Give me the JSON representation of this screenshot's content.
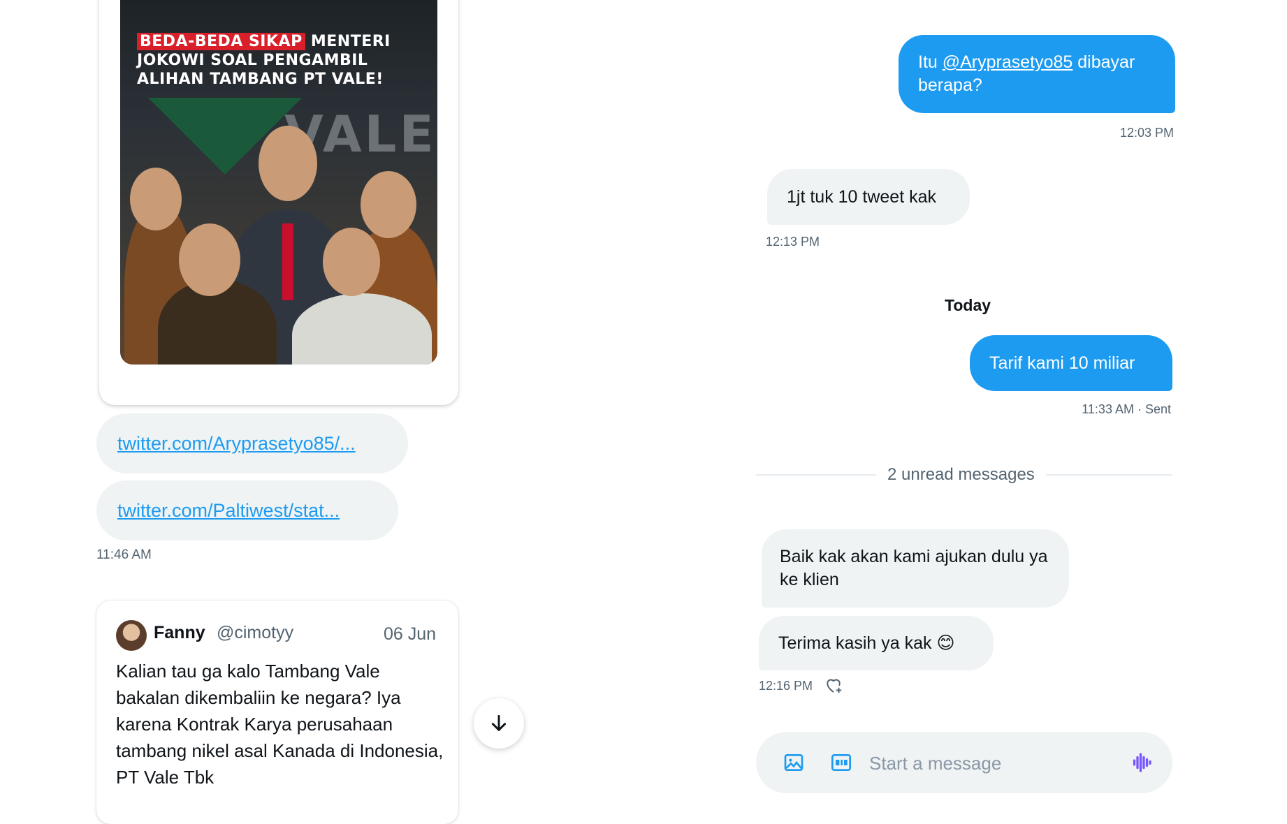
{
  "left": {
    "news_image": {
      "headline_highlight": "BEDA-BEDA SIKAP",
      "headline_rest": " MENTERI JOKOWI SOAL PENGAMBIL ALIHAN TAMBANG PT VALE!",
      "brand_word": "VALE"
    },
    "links": [
      "twitter.com/Aryprasetyo85/...",
      "twitter.com/Paltiwest/stat..."
    ],
    "links_time": "11:46 AM",
    "quoted_tweet": {
      "name": "Fanny",
      "handle": "@cimotyy",
      "date": "06 Jun",
      "text": "Kalian tau ga kalo Tambang Vale bakalan dikembaliin ke negara? Iya karena Kontrak Karya perusahaan tambang nikel asal Kanada di Indonesia, PT Vale Tbk"
    }
  },
  "dm": {
    "messages": [
      {
        "from": "me",
        "text_before": "Itu ",
        "mention": "@Aryprasetyo85",
        "text_after": " dibayar berapa?",
        "time": "12:03 PM"
      },
      {
        "from": "them",
        "text": "1jt tuk 10 tweet kak",
        "time": "12:13 PM"
      },
      {
        "from": "me",
        "text": "Tarif kami 10 miliar",
        "time": "11:33 AM · Sent"
      },
      {
        "from": "them",
        "text": "Baik kak akan kami ajukan dulu ya ke klien"
      },
      {
        "from": "them",
        "text": "Terima kasih ya kak 😊",
        "time": "12:16 PM"
      }
    ],
    "day_separator": "Today",
    "unread_divider": "2 unread messages",
    "composer": {
      "placeholder": "Start a message",
      "icons": [
        "image-icon",
        "gif-icon",
        "voice-icon"
      ]
    }
  },
  "colors": {
    "accent": "#1d9bf0",
    "bubble_received": "#eff3f4",
    "muted_text": "#536471"
  }
}
